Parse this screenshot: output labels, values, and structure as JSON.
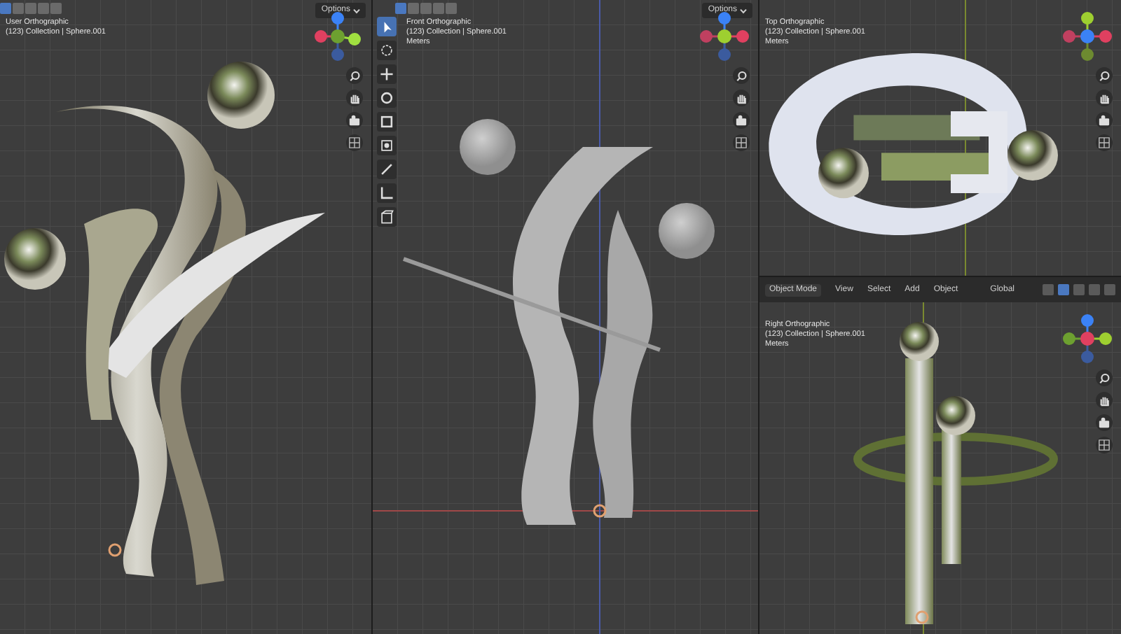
{
  "viewports": [
    {
      "kind": "user",
      "view": "User Orthographic",
      "context": "(123) Collection | Sphere.001",
      "options": "Options"
    },
    {
      "kind": "front",
      "view": "Front Orthographic",
      "context": "(123) Collection | Sphere.001",
      "units": "Meters",
      "options": "Options",
      "tools": [
        {
          "selected": true
        },
        {
          "selected": false
        },
        {
          "selected": false
        },
        {
          "selected": false
        },
        {
          "selected": false
        },
        {
          "selected": false
        },
        {
          "selected": false
        },
        {
          "selected": false
        },
        {
          "selected": false
        }
      ]
    },
    {
      "kind": "top",
      "view": "Top Orthographic",
      "context": "(123) Collection | Sphere.001",
      "units": "Meters"
    },
    {
      "kind": "right",
      "view": "Right Orthographic",
      "context": "(123) Collection | Sphere.001",
      "units": "Meters",
      "menus": [
        "Object Mode",
        "View",
        "Select",
        "Add",
        "Object"
      ],
      "orientation": "Global"
    }
  ]
}
